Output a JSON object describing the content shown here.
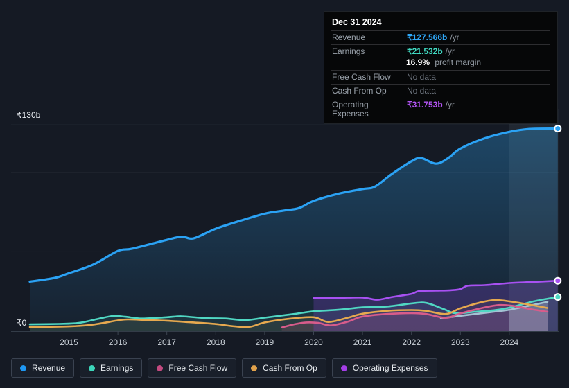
{
  "tooltip": {
    "date": "Dec 31 2024",
    "revenue": {
      "label": "Revenue",
      "value": "₹127.566b",
      "unit": "/yr"
    },
    "earnings": {
      "label": "Earnings",
      "value": "₹21.532b",
      "unit": "/yr",
      "margin_value": "16.9%",
      "margin_label": "profit margin"
    },
    "free_cash_flow": {
      "label": "Free Cash Flow",
      "value": "No data"
    },
    "cash_from_op": {
      "label": "Cash From Op",
      "value": "No data"
    },
    "operating_expenses": {
      "label": "Operating Expenses",
      "value": "₹31.753b",
      "unit": "/yr"
    }
  },
  "legend": {
    "items": [
      {
        "key": "revenue",
        "label": "Revenue",
        "color": "#1e97f2"
      },
      {
        "key": "earnings",
        "label": "Earnings",
        "color": "#3cd6ba"
      },
      {
        "key": "free-cash-flow",
        "label": "Free Cash Flow",
        "color": "#c34a80"
      },
      {
        "key": "cash-from-op",
        "label": "Cash From Op",
        "color": "#e0a14b"
      },
      {
        "key": "operating-expenses",
        "label": "Operating Expenses",
        "color": "#a43ee6"
      }
    ]
  },
  "chart_data": {
    "type": "area",
    "currency_unit": "₹ billions",
    "y_axis_labels": [
      "₹130b",
      "₹0"
    ],
    "ylim": [
      0,
      130
    ],
    "xlim": [
      2014.2,
      2025.0
    ],
    "x_ticks": [
      2015,
      2016,
      2017,
      2018,
      2019,
      2020,
      2021,
      2022,
      2023,
      2024
    ],
    "gridline_values": [
      130,
      100,
      50
    ],
    "grid": true,
    "legend_position": "bottom",
    "highlight_band": {
      "from": 2024.0,
      "to": 2025.0
    },
    "series": [
      {
        "key": "revenue",
        "name": "Revenue",
        "color": "#2ba2f4",
        "width": 3.2,
        "marker": true,
        "fill": "gradient",
        "points": [
          [
            2014.2,
            31.2
          ],
          [
            2014.7,
            33.5
          ],
          [
            2015,
            36.5
          ],
          [
            2015.5,
            42
          ],
          [
            2016,
            50.5
          ],
          [
            2016.3,
            52
          ],
          [
            2017,
            57.5
          ],
          [
            2017.3,
            59.5
          ],
          [
            2017.55,
            58.5
          ],
          [
            2018,
            64.5
          ],
          [
            2018.5,
            69.5
          ],
          [
            2019,
            74
          ],
          [
            2019.4,
            76
          ],
          [
            2019.7,
            77.5
          ],
          [
            2020,
            82
          ],
          [
            2020.5,
            86.5
          ],
          [
            2021,
            89.5
          ],
          [
            2021.25,
            91
          ],
          [
            2021.6,
            99
          ],
          [
            2022,
            107
          ],
          [
            2022.2,
            109
          ],
          [
            2022.5,
            105.5
          ],
          [
            2022.75,
            109
          ],
          [
            2023,
            115
          ],
          [
            2023.5,
            121.5
          ],
          [
            2024,
            125.5
          ],
          [
            2024.4,
            127.3
          ],
          [
            2024.99,
            127.566
          ]
        ]
      },
      {
        "key": "unlabeled",
        "name": "(unlabeled pale line)",
        "color": "#a4c3d4",
        "width": 2.6,
        "marker": false,
        "fill": "rgba(205,222,238,0.28)",
        "fill_above": true,
        "fill_from": 2024,
        "points": [
          [
            2022.6,
            8.2
          ],
          [
            2022.9,
            9.3
          ],
          [
            2023.3,
            10.8
          ],
          [
            2023.7,
            12.3
          ],
          [
            2024,
            13.5
          ],
          [
            2024.4,
            16
          ],
          [
            2024.78,
            18.5
          ]
        ]
      },
      {
        "key": "earnings",
        "name": "Earnings",
        "color": "#50d7c3",
        "width": 2.6,
        "marker": true,
        "fill": "rgba(80,215,195,0.10)",
        "points": [
          [
            2014.2,
            4.3
          ],
          [
            2014.8,
            4.6
          ],
          [
            2015.2,
            5.2
          ],
          [
            2015.6,
            7.8
          ],
          [
            2015.9,
            9.6
          ],
          [
            2016.15,
            9.1
          ],
          [
            2016.5,
            8
          ],
          [
            2017,
            8.8
          ],
          [
            2017.3,
            9.4
          ],
          [
            2017.8,
            8.2
          ],
          [
            2018.2,
            8
          ],
          [
            2018.6,
            7
          ],
          [
            2019,
            8.5
          ],
          [
            2019.6,
            10.8
          ],
          [
            2020,
            12.5
          ],
          [
            2020.5,
            13.5
          ],
          [
            2021,
            15
          ],
          [
            2021.5,
            15.5
          ],
          [
            2022,
            17.5
          ],
          [
            2022.3,
            17.8
          ],
          [
            2022.65,
            14
          ],
          [
            2022.9,
            11.3
          ],
          [
            2023.3,
            12.2
          ],
          [
            2023.7,
            13.2
          ],
          [
            2024,
            14.8
          ],
          [
            2024.5,
            18.8
          ],
          [
            2024.99,
            21.532
          ]
        ]
      },
      {
        "key": "cash-from-op",
        "name": "Cash From Op",
        "color": "#e6a94f",
        "width": 2.6,
        "marker": false,
        "fill": "rgba(230,169,79,0.08)",
        "points": [
          [
            2014.2,
            2.6
          ],
          [
            2015,
            3
          ],
          [
            2015.5,
            4.2
          ],
          [
            2016,
            6.8
          ],
          [
            2016.2,
            7.4
          ],
          [
            2016.6,
            7
          ],
          [
            2017,
            6.6
          ],
          [
            2017.5,
            5.6
          ],
          [
            2018,
            4.5
          ],
          [
            2018.4,
            3
          ],
          [
            2018.7,
            2.8
          ],
          [
            2019,
            5.5
          ],
          [
            2019.5,
            7.8
          ],
          [
            2020,
            8.8
          ],
          [
            2020.3,
            5.8
          ],
          [
            2020.7,
            8.5
          ],
          [
            2021,
            11
          ],
          [
            2021.5,
            12.8
          ],
          [
            2022,
            13.3
          ],
          [
            2022.3,
            12.8
          ],
          [
            2022.7,
            10.8
          ],
          [
            2023,
            14.4
          ],
          [
            2023.4,
            18
          ],
          [
            2023.7,
            19.6
          ],
          [
            2024,
            18.8
          ],
          [
            2024.4,
            16.8
          ],
          [
            2024.78,
            14.6
          ]
        ]
      },
      {
        "key": "free-cash-flow",
        "name": "Free Cash Flow",
        "color": "#d85c8b",
        "width": 2.6,
        "marker": false,
        "fill": "rgba(216,92,139,0.15)",
        "points": [
          [
            2019.35,
            2.3
          ],
          [
            2019.6,
            4.3
          ],
          [
            2019.85,
            5.5
          ],
          [
            2020.1,
            5.2
          ],
          [
            2020.35,
            3.6
          ],
          [
            2020.7,
            6
          ],
          [
            2021,
            9.2
          ],
          [
            2021.5,
            10.8
          ],
          [
            2022,
            11.4
          ],
          [
            2022.3,
            10.8
          ],
          [
            2022.7,
            8.4
          ],
          [
            2023,
            11.2
          ],
          [
            2023.5,
            15
          ],
          [
            2023.8,
            16.5
          ],
          [
            2024.05,
            16
          ],
          [
            2024.45,
            13.8
          ],
          [
            2024.78,
            12.2
          ]
        ]
      },
      {
        "key": "operating-expenses",
        "name": "Operating Expenses",
        "color": "#a851f2",
        "width": 2.6,
        "marker": true,
        "fill": "rgba(125,70,205,0.28)",
        "points": [
          [
            2020,
            20.8
          ],
          [
            2020.5,
            21
          ],
          [
            2021,
            21.2
          ],
          [
            2021.3,
            19.8
          ],
          [
            2021.6,
            21.5
          ],
          [
            2022,
            23.5
          ],
          [
            2022.15,
            25.2
          ],
          [
            2022.5,
            25.5
          ],
          [
            2022.8,
            25.8
          ],
          [
            2023,
            26.5
          ],
          [
            2023.15,
            28.6
          ],
          [
            2023.5,
            29
          ],
          [
            2024,
            30.3
          ],
          [
            2024.5,
            31
          ],
          [
            2024.99,
            31.753
          ]
        ]
      }
    ]
  }
}
